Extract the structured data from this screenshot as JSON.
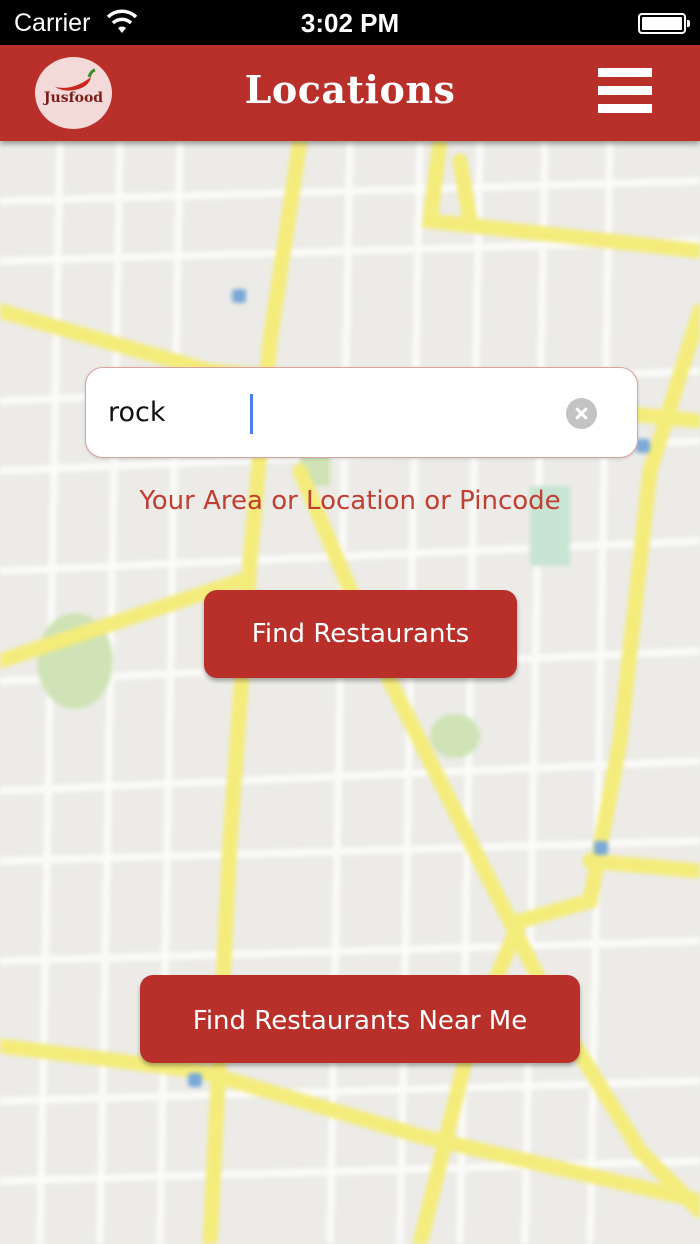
{
  "status_bar": {
    "carrier": "Carrier",
    "time": "3:02 PM"
  },
  "header": {
    "logo_text": "Jusfood",
    "title": "Locations"
  },
  "search": {
    "value": "rock",
    "hint": "Your Area or Location or Pincode"
  },
  "buttons": {
    "find": "Find Restaurants",
    "near_me": "Find Restaurants Near Me"
  },
  "colors": {
    "brand": "#b9302a",
    "hint": "#c13e33",
    "map_road": "#f4ec7a"
  }
}
